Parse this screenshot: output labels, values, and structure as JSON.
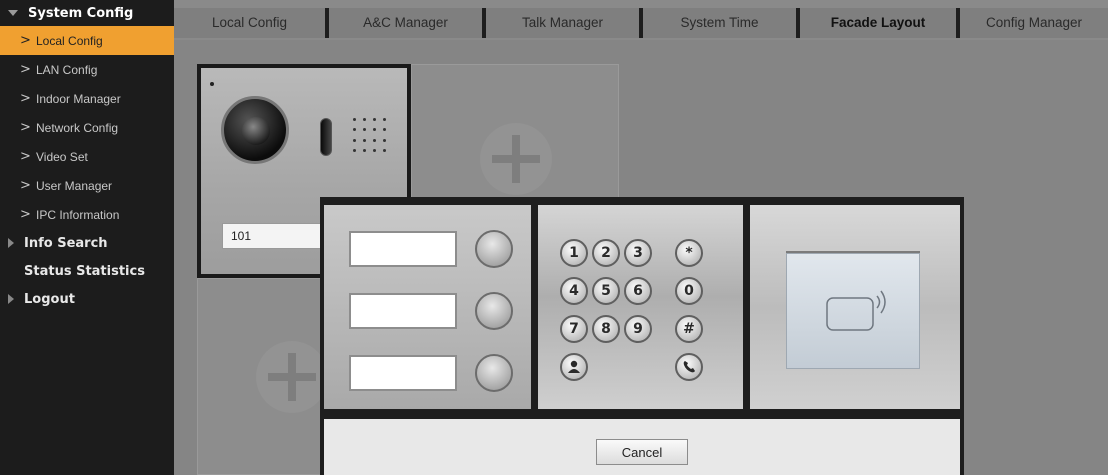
{
  "sidebar": {
    "header": "System Config",
    "items": [
      {
        "label": "Local Config",
        "active": true
      },
      {
        "label": "LAN Config"
      },
      {
        "label": "Indoor Manager"
      },
      {
        "label": "Network Config"
      },
      {
        "label": "Video Set"
      },
      {
        "label": "User Manager"
      },
      {
        "label": "IPC Information"
      }
    ],
    "groups": [
      "Info Search",
      "Status Statistics",
      "Logout"
    ]
  },
  "tabs": [
    {
      "label": "Local Config"
    },
    {
      "label": "A&C Manager"
    },
    {
      "label": "Talk Manager"
    },
    {
      "label": "System Time"
    },
    {
      "label": "Facade Layout",
      "active": true
    },
    {
      "label": "Config Manager"
    }
  ],
  "camera_module": {
    "label": "101"
  },
  "keypad": {
    "keys": [
      "1",
      "2",
      "3",
      "*",
      "4",
      "5",
      "6",
      "0",
      "7",
      "8",
      "9",
      "#"
    ],
    "contact_icon": "contact-icon",
    "call_icon": "phone-icon"
  },
  "modal": {
    "cancel_label": "Cancel"
  },
  "colors": {
    "accent": "#f0a030",
    "sidebar_bg": "#1c1c1c"
  }
}
